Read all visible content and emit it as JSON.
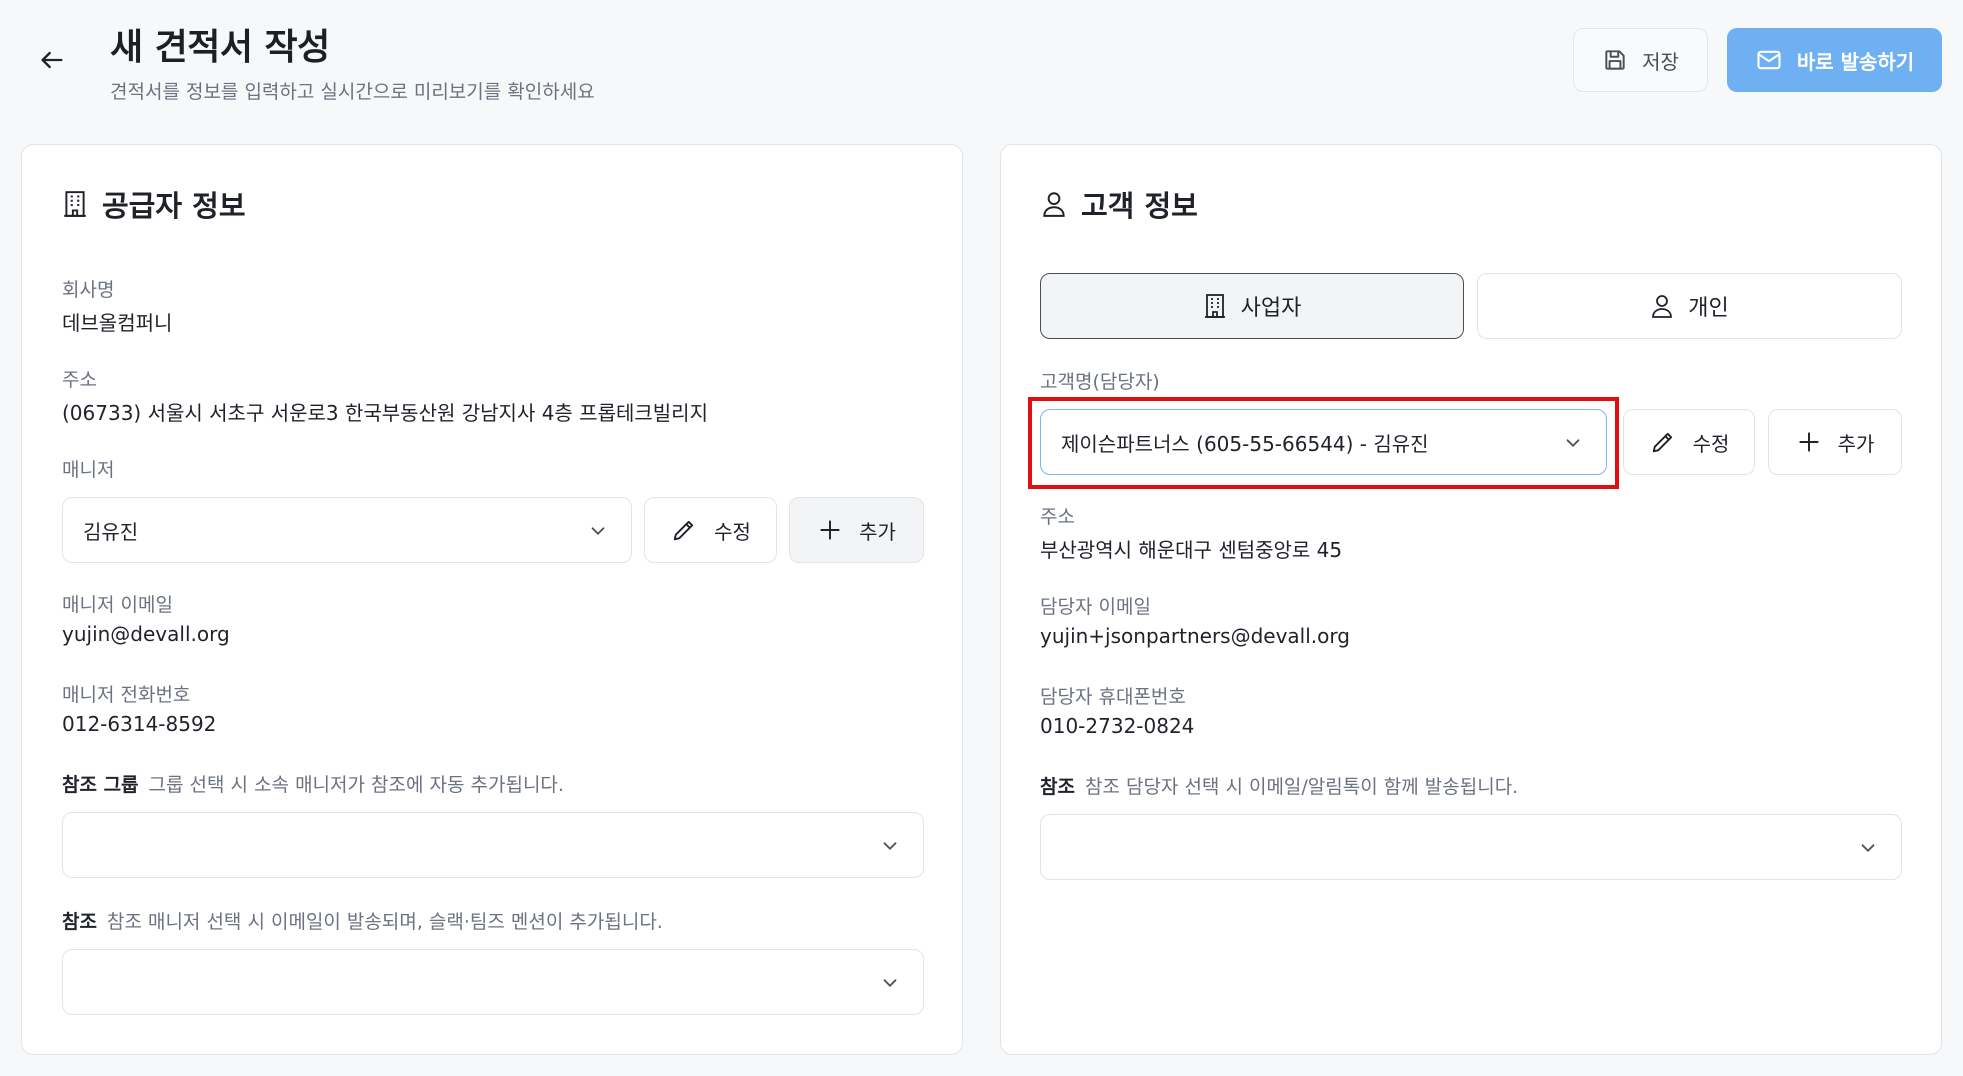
{
  "header": {
    "title": "새 견적서 작성",
    "subtitle": "견적서를 정보를 입력하고 실시간으로 미리보기를 확인하세요",
    "save_label": "저장",
    "send_label": "바로 발송하기"
  },
  "supplier": {
    "title": "공급자 정보",
    "company_label": "회사명",
    "company_value": "데브올컴퍼니",
    "address_label": "주소",
    "address_value": "(06733) 서울시 서초구 서운로3 한국부동산원 강남지사 4층 프롭테크빌리지",
    "manager_label": "매니저",
    "manager_selected": "김유진",
    "edit_label": "수정",
    "add_label": "추가",
    "manager_email_label": "매니저 이메일",
    "manager_email_value": "yujin@devall.org",
    "manager_phone_label": "매니저 전화번호",
    "manager_phone_value": "012-6314-8592",
    "cc_group_label": "참조 그룹",
    "cc_group_hint": "그룹 선택 시 소속 매니저가 참조에 자동 추가됩니다.",
    "cc_label": "참조",
    "cc_hint": "참조 매니저 선택 시 이메일이 발송되며, 슬랙·팀즈 멘션이 추가됩니다."
  },
  "customer": {
    "title": "고객 정보",
    "type_business": "사업자",
    "type_individual": "개인",
    "name_label": "고객명(담당자)",
    "name_selected": "제이슨파트너스 (605-55-66544) - 김유진",
    "edit_label": "수정",
    "add_label": "추가",
    "address_label": "주소",
    "address_value": "부산광역시 해운대구 센텀중앙로 45",
    "email_label": "담당자 이메일",
    "email_value": "yujin+jsonpartners@devall.org",
    "phone_label": "담당자 휴대폰번호",
    "phone_value": "010-2732-0824",
    "cc_label": "참조",
    "cc_hint": "참조 담당자 선택 시 이메일/알림톡이 함께 발송됩니다."
  },
  "colors": {
    "primary_button": "#6fb0f3",
    "highlight": "#e01010"
  },
  "icons": [
    "arrow-left-icon",
    "save-icon",
    "mail-icon",
    "building-icon",
    "user-icon",
    "pencil-icon",
    "plus-icon",
    "chevron-down-icon"
  ]
}
